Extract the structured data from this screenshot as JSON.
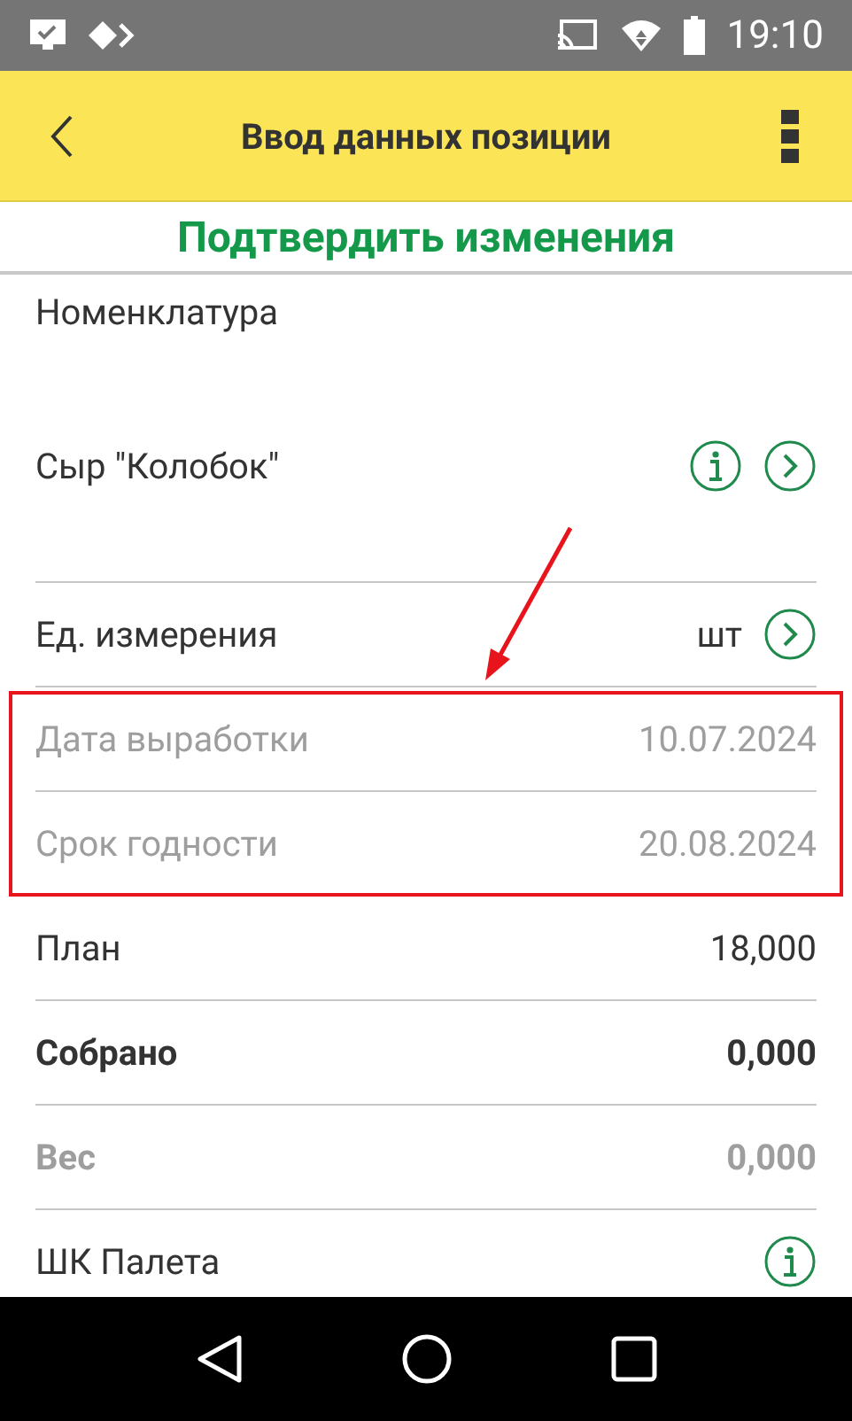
{
  "status_bar": {
    "time": "19:10"
  },
  "toolbar": {
    "title": "Ввод данных позиции"
  },
  "confirm_button": {
    "label": "Подтвердить изменения"
  },
  "rows": [
    {
      "kind": "header",
      "label": "Номенклатура"
    },
    {
      "kind": "value",
      "value": "Сыр \"Колобок\"",
      "info": true,
      "open": true
    },
    {
      "kind": "field",
      "label": "Ед. измерения",
      "value": "шт",
      "disabled": false,
      "bold": false,
      "info": false,
      "open": true
    },
    {
      "kind": "field",
      "label": "Дата выработки",
      "value": "10.07.2024",
      "disabled": true,
      "bold": false,
      "info": false,
      "open": false
    },
    {
      "kind": "field",
      "label": "Срок годности",
      "value": "20.08.2024",
      "disabled": true,
      "bold": false,
      "info": false,
      "open": false
    },
    {
      "kind": "field",
      "label": "План",
      "value": "18,000",
      "disabled": false,
      "bold": false,
      "info": false,
      "open": false
    },
    {
      "kind": "field",
      "label": "Собрано",
      "value": "0,000",
      "disabled": false,
      "bold": true,
      "info": false,
      "open": false
    },
    {
      "kind": "field",
      "label": "Вес",
      "value": "0,000",
      "disabled": true,
      "bold": true,
      "info": false,
      "open": false
    },
    {
      "kind": "field",
      "label": "ШК Палета",
      "disabled": false,
      "bold": false,
      "info": true,
      "open": false
    }
  ]
}
